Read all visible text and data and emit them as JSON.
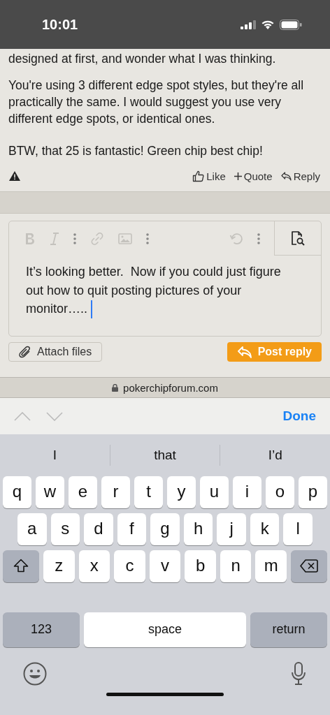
{
  "status_bar": {
    "time": "10:01"
  },
  "post": {
    "paragraphs": [
      "designed at first, and wonder what I was thinking.",
      "You're using 3 different edge spot styles, but they're all practically the same. I would suggest you use very different edge spots, or identical ones.",
      "BTW, that 25 is fantastic! Green chip best chip!"
    ],
    "actions": [
      {
        "kind": "like",
        "label": "Like"
      },
      {
        "kind": "quote",
        "label": "Quote"
      },
      {
        "kind": "reply",
        "label": "Reply"
      }
    ]
  },
  "editor": {
    "toolbar": [
      {
        "kind": "bold",
        "disabled": true
      },
      {
        "kind": "italic",
        "disabled": true
      },
      {
        "kind": "more",
        "disabled": false
      },
      {
        "kind": "link",
        "disabled": true
      },
      {
        "kind": "image",
        "disabled": true
      },
      {
        "kind": "more",
        "disabled": false
      },
      {
        "kind": "undo",
        "disabled": true
      },
      {
        "kind": "more",
        "disabled": false
      }
    ],
    "value": "It’s looking better.  Now if you could just figure out how to quit posting pictures of your monitor….. ",
    "buttons": [
      {
        "kind": "attach",
        "label": "Attach files"
      },
      {
        "kind": "post",
        "label": "Post reply"
      }
    ]
  },
  "url_bar": {
    "url": "pokerchipforum.com"
  },
  "accessory": {
    "done": "Done"
  },
  "suggestions": [
    "I",
    "that",
    "I’d"
  ],
  "keyboard": [
    [
      {
        "kind": "letter",
        "label": "q"
      },
      {
        "kind": "letter",
        "label": "w"
      },
      {
        "kind": "letter",
        "label": "e"
      },
      {
        "kind": "letter",
        "label": "r"
      },
      {
        "kind": "letter",
        "label": "t"
      },
      {
        "kind": "letter",
        "label": "y"
      },
      {
        "kind": "letter",
        "label": "u"
      },
      {
        "kind": "letter",
        "label": "i"
      },
      {
        "kind": "letter",
        "label": "o"
      },
      {
        "kind": "letter",
        "label": "p"
      }
    ],
    [
      {
        "kind": "letter",
        "label": "a"
      },
      {
        "kind": "letter",
        "label": "s"
      },
      {
        "kind": "letter",
        "label": "d"
      },
      {
        "kind": "letter",
        "label": "f"
      },
      {
        "kind": "letter",
        "label": "g"
      },
      {
        "kind": "letter",
        "label": "h"
      },
      {
        "kind": "letter",
        "label": "j"
      },
      {
        "kind": "letter",
        "label": "k"
      },
      {
        "kind": "letter",
        "label": "l"
      }
    ],
    [
      {
        "kind": "shift"
      },
      {
        "kind": "letter",
        "label": "z"
      },
      {
        "kind": "letter",
        "label": "x"
      },
      {
        "kind": "letter",
        "label": "c"
      },
      {
        "kind": "letter",
        "label": "v"
      },
      {
        "kind": "letter",
        "label": "b"
      },
      {
        "kind": "letter",
        "label": "n"
      },
      {
        "kind": "letter",
        "label": "m"
      },
      {
        "kind": "backspace"
      }
    ],
    [
      {
        "kind": "numbers",
        "label": "123"
      },
      {
        "kind": "space",
        "label": "space"
      },
      {
        "kind": "return",
        "label": "return"
      }
    ]
  ]
}
